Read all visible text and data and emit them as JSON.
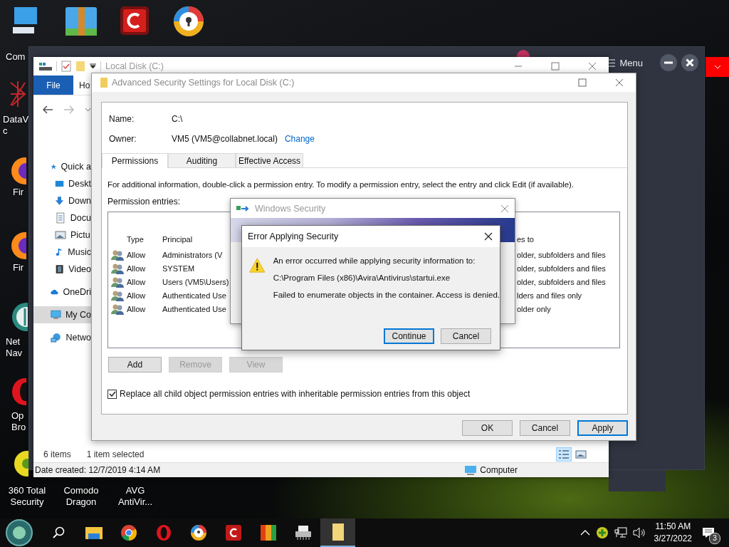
{
  "desktop_icons": [
    {
      "kind": "computer",
      "lines": [
        "Com"
      ]
    },
    {
      "kind": "zip"
    },
    {
      "kind": "comodo"
    },
    {
      "kind": "secure-browser"
    },
    {
      "kind": "network-art",
      "lines": [
        "DataV",
        "c"
      ]
    },
    {
      "kind": "firefox",
      "lines": [
        "Fir"
      ]
    },
    {
      "kind": "firefox",
      "lines": [
        "Fir"
      ]
    },
    {
      "kind": "globe",
      "lines": [
        "Net",
        "Nav"
      ]
    },
    {
      "kind": "opera",
      "lines": [
        "Op",
        "Bro"
      ]
    },
    {
      "kind": "total-security",
      "lines": [
        "360 Total",
        "Security"
      ]
    },
    {
      "kind": "none",
      "lines": [
        "Comodo",
        "Dragon"
      ]
    },
    {
      "kind": "none",
      "lines": [
        "AVG",
        "AntiVir..."
      ]
    }
  ],
  "background_app": {
    "menu_label": "Menu"
  },
  "explorer": {
    "title": "Local Disk (C:)",
    "ribbon_tabs": [
      {
        "label": "File",
        "selected": true
      },
      {
        "label": "Ho",
        "selected": false
      }
    ],
    "nav_items": [
      {
        "label": "Quick a",
        "kind": "star",
        "selected": false,
        "children": [
          {
            "label": "Deskt",
            "kind": "desktop",
            "selected": false
          },
          {
            "label": "Down",
            "kind": "download",
            "selected": false
          },
          {
            "label": "Docu",
            "kind": "document",
            "selected": false
          },
          {
            "label": "Pictu",
            "kind": "picture",
            "selected": false
          },
          {
            "label": "Music",
            "kind": "music",
            "selected": false
          },
          {
            "label": "Video",
            "kind": "video",
            "selected": false
          }
        ]
      },
      {
        "label": "OneDri",
        "kind": "cloud",
        "selected": false
      },
      {
        "label": "My Co",
        "kind": "monitor",
        "selected": true
      },
      {
        "label": "Netwo",
        "kind": "network",
        "selected": false
      }
    ],
    "item_count": "6 items",
    "selection": "1 item selected",
    "views": [
      {
        "kind": "details",
        "selected": true
      },
      {
        "kind": "tiles",
        "selected": false
      }
    ],
    "details": "Date created: 12/7/2019 4:14 AM",
    "location": "Computer"
  },
  "security_settings": {
    "title": "Advanced Security Settings for Local Disk (C:)",
    "name_label": "Name:",
    "name": "C:\\",
    "owner_label": "Owner:",
    "owner": "VM5 (VM5@collabnet.local)",
    "owner_link": "Change",
    "tabs": [
      {
        "label": "Permissions",
        "selected": true
      },
      {
        "label": "Auditing",
        "selected": false
      },
      {
        "label": "Effective Access",
        "selected": false
      }
    ],
    "info": "For additional information, double-click a permission entry. To modify a permission entry, select the entry and click Edit (if available).",
    "entries_label": "Permission entries:",
    "columns": [
      "Type",
      "Principal",
      "es to"
    ],
    "rows": [
      {
        "type": "Allow",
        "principal": "Administrators (V",
        "applies_to": "older, subfolders and files"
      },
      {
        "type": "Allow",
        "principal": "SYSTEM",
        "applies_to": "older, subfolders and files"
      },
      {
        "type": "Allow",
        "principal": "Users (VM5\\Users)",
        "applies_to": "older, subfolders and files"
      },
      {
        "type": "Allow",
        "principal": "Authenticated Use",
        "applies_to": "lders and files only"
      },
      {
        "type": "Allow",
        "principal": "Authenticated Use",
        "applies_to": "older only"
      }
    ],
    "list_buttons": [
      {
        "label": "Add",
        "disabled": false
      },
      {
        "label": "Remove",
        "disabled": true
      },
      {
        "label": "View",
        "disabled": true
      }
    ],
    "replace_option": {
      "label": "Replace all child object permission entries with inheritable permission entries from this object",
      "checked": true
    },
    "buttons": [
      {
        "label": "OK",
        "default": false
      },
      {
        "label": "Cancel",
        "default": false
      },
      {
        "label": "Apply",
        "default": true
      }
    ]
  },
  "windows_security": {
    "title": "Windows Security"
  },
  "error_dialog": {
    "title": "Error Applying Security",
    "lines": [
      "An error occurred while applying security information to:",
      "C:\\Program Files (x86)\\Avira\\Antivirus\\startui.exe",
      "Failed to enumerate objects in the container. Access is denied."
    ],
    "buttons": [
      {
        "label": "Continue",
        "default": true
      },
      {
        "label": "Cancel",
        "default": false
      }
    ]
  },
  "taskbar": {
    "apps": [
      {
        "kind": "folder",
        "active": false
      },
      {
        "kind": "chrome",
        "active": false
      },
      {
        "kind": "opera",
        "active": false
      },
      {
        "kind": "secure-browser",
        "active": false
      },
      {
        "kind": "comodo",
        "active": false
      },
      {
        "kind": "avg",
        "active": false
      },
      {
        "kind": "printer",
        "active": false
      },
      {
        "kind": "file",
        "active": true
      }
    ],
    "time": "11:50 AM",
    "date": "3/27/2022",
    "notifications": "3"
  }
}
